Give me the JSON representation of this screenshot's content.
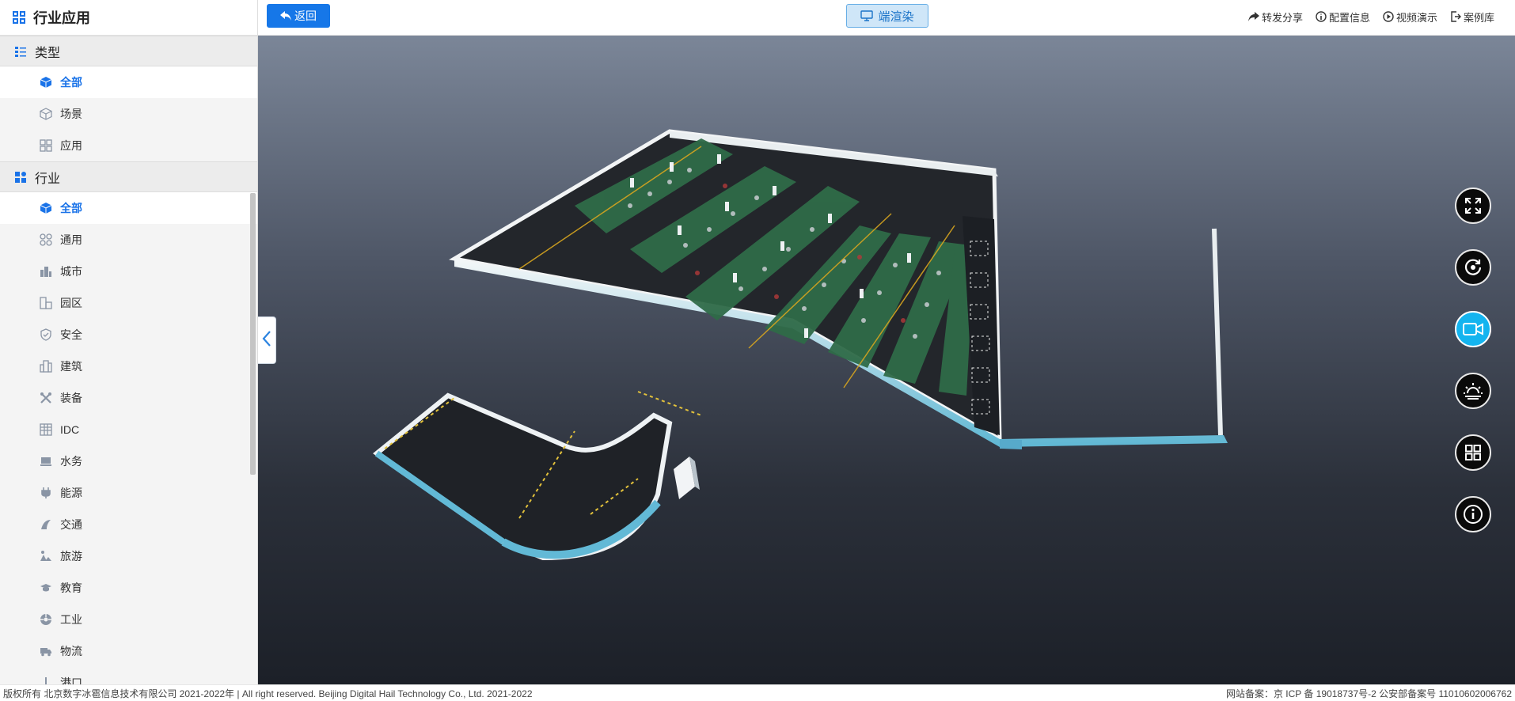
{
  "sidebar": {
    "title": "行业应用",
    "sections": [
      {
        "label": "类型",
        "items": [
          {
            "label": "全部",
            "icon": "cube-icon",
            "active": true
          },
          {
            "label": "场景",
            "icon": "cube-outline-icon"
          },
          {
            "label": "应用",
            "icon": "grid-icon"
          }
        ]
      },
      {
        "label": "行业",
        "items": [
          {
            "label": "全部",
            "icon": "cube-icon",
            "active": true
          },
          {
            "label": "通用",
            "icon": "apps-icon"
          },
          {
            "label": "城市",
            "icon": "city-icon"
          },
          {
            "label": "园区",
            "icon": "park-icon"
          },
          {
            "label": "安全",
            "icon": "shield-icon"
          },
          {
            "label": "建筑",
            "icon": "building-icon"
          },
          {
            "label": "装备",
            "icon": "tools-icon"
          },
          {
            "label": "IDC",
            "icon": "server-icon"
          },
          {
            "label": "水务",
            "icon": "water-icon"
          },
          {
            "label": "能源",
            "icon": "plug-icon"
          },
          {
            "label": "交通",
            "icon": "traffic-icon"
          },
          {
            "label": "旅游",
            "icon": "tour-icon"
          },
          {
            "label": "教育",
            "icon": "graduation-icon"
          },
          {
            "label": "工业",
            "icon": "industry-icon"
          },
          {
            "label": "物流",
            "icon": "truck-icon"
          },
          {
            "label": "港口",
            "icon": "port-icon"
          }
        ]
      }
    ]
  },
  "topbar": {
    "back_label": "返回",
    "render_label": "端渲染",
    "links": [
      "转发分享",
      "配置信息",
      "视频演示",
      "案例库"
    ]
  },
  "tools": [
    "fullscreen-icon",
    "rotate-icon",
    "video-icon",
    "weather-icon",
    "layout-icon",
    "info-icon"
  ],
  "footer": {
    "left": "版权所有 北京数字冰雹信息技术有限公司 2021-2022年 | All right reserved. Beijing Digital Hail Technology Co., Ltd. 2021-2022",
    "right": "网站备案：京 ICP 备 19018737号-2 公安部备案号 11010602006762"
  },
  "colors": {
    "accent": "#1677e8",
    "active_tool": "#14b4ef"
  }
}
